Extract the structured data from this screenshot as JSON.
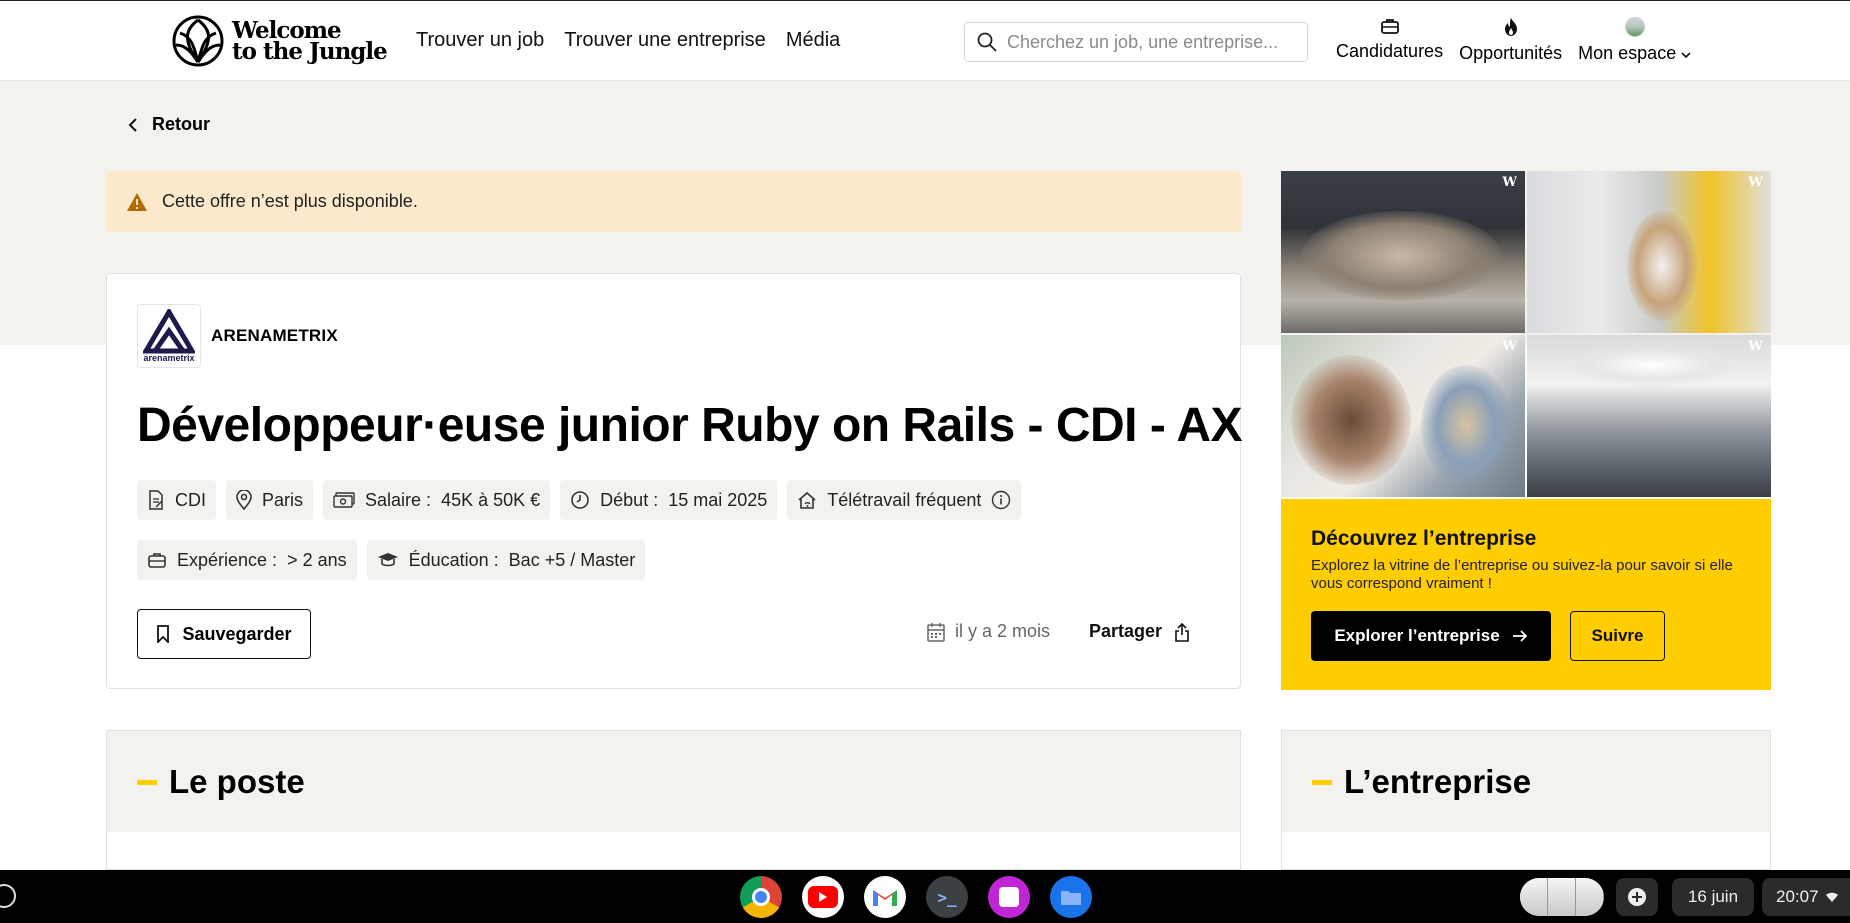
{
  "header": {
    "logo_line1": "Welcome",
    "logo_line2": "to the Jungle",
    "nav": [
      "Trouver un job",
      "Trouver une entreprise",
      "Média"
    ],
    "search_placeholder": "Cherchez un job, une entreprise...",
    "user_nav": [
      "Candidatures",
      "Opportunités",
      "Mon espace"
    ]
  },
  "back_label": "Retour",
  "alert_text": "Cette offre n’est plus disponible.",
  "job": {
    "company_name": "ARENAMETRIX",
    "company_logo_text": "arenametrix",
    "title": "Développeur·euse junior Ruby on Rails - CDI - AX",
    "tags": {
      "contract": "CDI",
      "location": "Paris",
      "salary_key": "Salaire :",
      "salary_val": "45K à 50K €",
      "start_key": "Début :",
      "start_val": "15 mai 2025",
      "remote": "Télétravail fréquent",
      "experience_key": "Expérience :",
      "experience_val": "> 2 ans",
      "education_key": "Éducation :",
      "education_val": "Bac +5 / Master"
    },
    "save_label": "Sauvegarder",
    "posted": "il y a 2 mois",
    "share_label": "Partager"
  },
  "company_box": {
    "title": "Découvrez l’entreprise",
    "description": "Explorez la vitrine de l’entreprise ou suivez-la pour savoir si elle vous correspond vraiment !",
    "explore_label": "Explorer l’entreprise",
    "follow_label": "Suivre",
    "photo_watermark": "W"
  },
  "sections": {
    "left_title": "Le poste",
    "right_title": "L’entreprise"
  },
  "taskbar": {
    "date": "16 juin",
    "time": "20:07",
    "apps": [
      "chrome-icon",
      "youtube-icon",
      "gmail-icon",
      "terminal-icon",
      "canvas-icon",
      "files-icon"
    ]
  },
  "colors": {
    "accent_yellow": "#ffcd00",
    "beige": "#f4f2ee",
    "alert_bg": "#fde9cc"
  }
}
